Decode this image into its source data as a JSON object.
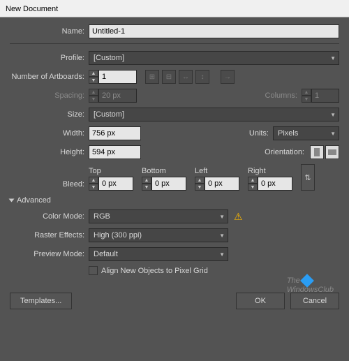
{
  "title": "New Document",
  "name": {
    "label": "Name:",
    "value": "Untitled-1"
  },
  "profile": {
    "label": "Profile:",
    "value": "[Custom]"
  },
  "artboards": {
    "label": "Number of Artboards:",
    "value": "1"
  },
  "spacing": {
    "label": "Spacing:",
    "value": "20 px"
  },
  "columns": {
    "label": "Columns:",
    "value": "1"
  },
  "size": {
    "label": "Size:",
    "value": "[Custom]"
  },
  "width": {
    "label": "Width:",
    "value": "756 px"
  },
  "units": {
    "label": "Units:",
    "value": "Pixels"
  },
  "height": {
    "label": "Height:",
    "value": "594 px"
  },
  "orientation": {
    "label": "Orientation:"
  },
  "bleed": {
    "label": "Bleed:",
    "top": {
      "label": "Top",
      "value": "0 px"
    },
    "bottom": {
      "label": "Bottom",
      "value": "0 px"
    },
    "left": {
      "label": "Left",
      "value": "0 px"
    },
    "right": {
      "label": "Right",
      "value": "0 px"
    }
  },
  "advanced": {
    "label": "Advanced",
    "colormode": {
      "label": "Color Mode:",
      "value": "RGB"
    },
    "raster": {
      "label": "Raster Effects:",
      "value": "High (300 ppi)"
    },
    "preview": {
      "label": "Preview Mode:",
      "value": "Default"
    },
    "align": "Align New Objects to Pixel Grid"
  },
  "buttons": {
    "templates": "Templates...",
    "ok": "OK",
    "cancel": "Cancel"
  },
  "watermark": {
    "l1": "The",
    "l2": "WindowsClub"
  }
}
